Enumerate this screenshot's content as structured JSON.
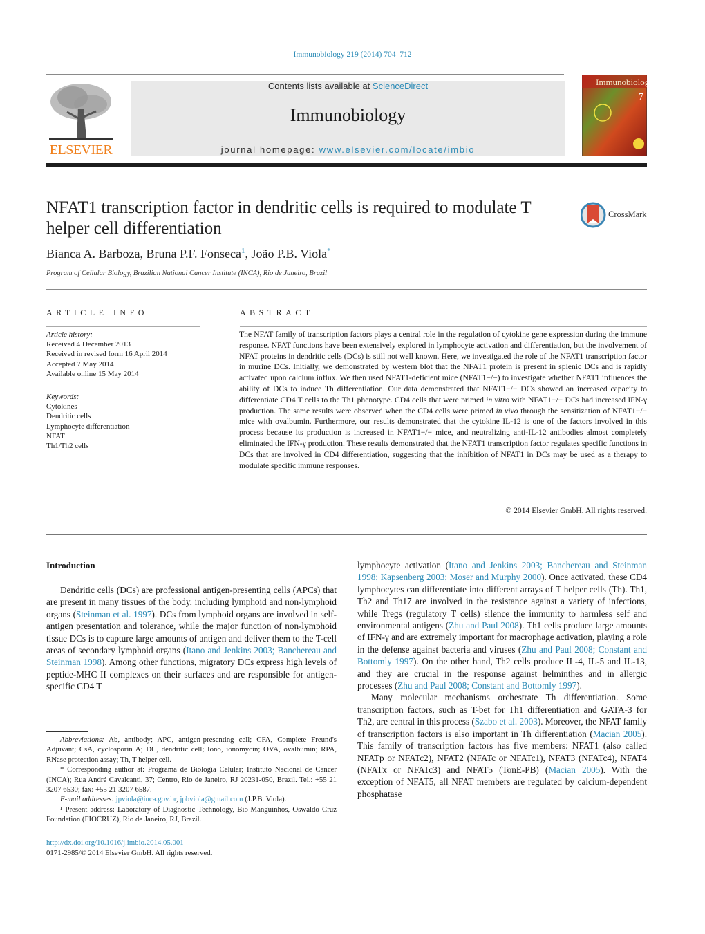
{
  "header": {
    "journal_ref": "Immunobiology 219 (2014) 704–712",
    "contents_prefix": "Contents lists available at ",
    "contents_link": "ScienceDirect",
    "journal_name": "Immunobiology",
    "homepage_prefix": "journal homepage: ",
    "homepage_link": "www.elsevier.com/locate/imbio",
    "publisher_logo": "ELSEVIER",
    "cover_title": "Immunobiology",
    "cover_issue": "7",
    "crossmark_label": "CrossMark"
  },
  "article": {
    "title": "NFAT1 transcription factor in dendritic cells is required to modulate T helper cell differentiation",
    "authors": [
      {
        "name": "Bianca A. Barboza",
        "mark": ""
      },
      {
        "name": "Bruna P.F. Fonseca",
        "mark": "1"
      },
      {
        "name": "João P.B. Viola",
        "mark": "*"
      }
    ],
    "affiliation": "Program of Cellular Biology, Brazilian National Cancer Institute (INCA), Rio de Janeiro, Brazil"
  },
  "article_info": {
    "heading": "ARTICLE INFO",
    "history_label": "Article history:",
    "history": [
      "Received 4 December 2013",
      "Received in revised form 16 April 2014",
      "Accepted 7 May 2014",
      "Available online 15 May 2014"
    ],
    "keywords_label": "Keywords:",
    "keywords": [
      "Cytokines",
      "Dendritic cells",
      "Lymphocyte differentiation",
      "NFAT",
      "Th1/Th2 cells"
    ]
  },
  "abstract": {
    "heading": "ABSTRACT",
    "p1": "The NFAT family of transcription factors plays a central role in the regulation of cytokine gene expression during the immune response. NFAT functions have been extensively explored in lymphocyte activation and differentiation, but the involvement of NFAT proteins in dendritic cells (DCs) is still not well known. Here, we investigated the role of the NFAT1 transcription factor in murine DCs. Initially, we demonstrated by western blot that the NFAT1 protein is present in splenic DCs and is rapidly activated upon calcium influx. We then used NFAT1-deficient mice (NFAT1−/−) to investigate whether NFAT1 influences the ability of DCs to induce Th differentiation. Our data demonstrated that NFAT1−/− DCs showed an increased capacity to differentiate CD4 T cells to the Th1 phenotype. CD4 cells that were primed ",
    "it1": "in vitro",
    "p2": " with NFAT1−/− DCs had increased IFN-γ production. The same results were observed when the CD4 cells were primed ",
    "it2": "in vivo",
    "p3": " through the sensitization of NFAT1−/− mice with ovalbumin. Furthermore, our results demonstrated that the cytokine IL-12 is one of the factors involved in this process because its production is increased in NFAT1−/− mice, and neutralizing anti-IL-12 antibodies almost completely eliminated the IFN-γ production. These results demonstrated that the NFAT1 transcription factor regulates specific functions in DCs that are involved in CD4 differentiation, suggesting that the inhibition of NFAT1 in DCs may be used as a therapy to modulate specific immune responses.",
    "copyright": "© 2014 Elsevier GmbH. All rights reserved."
  },
  "body": {
    "intro_heading": "Introduction",
    "left": [
      {
        "t": "Dendritic cells (DCs) are professional antigen-presenting cells (APCs) that are present in many tissues of the body, including lymphoid and non-lymphoid organs ("
      },
      {
        "l": "Steinman et al. 1997"
      },
      {
        "t": "). DCs from lymphoid organs are involved in self-antigen presentation and tolerance, while the major function of non-lymphoid tissue DCs is to capture large amounts of antigen and deliver them to the T-cell areas of secondary lymphoid organs ("
      },
      {
        "l": "Itano and Jenkins 2003; Banchereau and Steinman 1998"
      },
      {
        "t": "). Among other functions, migratory DCs express high levels of peptide-MHC II complexes on their surfaces and are responsible for antigen-specific CD4 T"
      }
    ],
    "right_p1": [
      {
        "t": "lymphocyte activation ("
      },
      {
        "l": "Itano and Jenkins 2003; Banchereau and Steinman 1998; Kapsenberg 2003; Moser and Murphy 2000"
      },
      {
        "t": "). Once activated, these CD4 lymphocytes can differentiate into different arrays of T helper cells (Th). Th1, Th2 and Th17 are involved in the resistance against a variety of infections, while Tregs (regulatory T cells) silence the immunity to harmless self and environmental antigens ("
      },
      {
        "l": "Zhu and Paul 2008"
      },
      {
        "t": "). Th1 cells produce large amounts of IFN-γ and are extremely important for macrophage activation, playing a role in the defense against bacteria and viruses ("
      },
      {
        "l": "Zhu and Paul 2008; Constant and Bottomly 1997"
      },
      {
        "t": "). On the other hand, Th2 cells produce IL-4, IL-5 and IL-13, and they are crucial in the response against helminthes and in allergic processes ("
      },
      {
        "l": "Zhu and Paul 2008; Constant and Bottomly 1997"
      },
      {
        "t": ")."
      }
    ],
    "right_p2": [
      {
        "t": "Many molecular mechanisms orchestrate Th differentiation. Some transcription factors, such as T-bet for Th1 differentiation and GATA-3 for Th2, are central in this process ("
      },
      {
        "l": "Szabo et al. 2003"
      },
      {
        "t": "). Moreover, the NFAT family of transcription factors is also important in Th differentiation ("
      },
      {
        "l": "Macian 2005"
      },
      {
        "t": "). This family of transcription factors has five members: NFAT1 (also called NFATp or NFATc2), NFAT2 (NFATc or NFATc1), NFAT3 (NFATc4), NFAT4 (NFATx or NFATc3) and NFAT5 (TonE-PB) ("
      },
      {
        "l": "Macian 2005"
      },
      {
        "t": "). With the exception of NFAT5, all NFAT members are regulated by calcium-dependent phosphatase"
      }
    ]
  },
  "footnotes": {
    "abbrev_label": "Abbreviations:",
    "abbrev": " Ab, antibody; APC, antigen-presenting cell; CFA, Complete Freund's Adjuvant; CsA, cyclosporin A; DC, dendritic cell; Iono, ionomycin; OVA, ovalbumin; RPA, RNase protection assay; Th, T helper cell.",
    "corresponding": "* Corresponding author at: Programa de Biologia Celular; Instituto Nacional de Câncer (INCA); Rua André Cavalcanti, 37; Centro, Rio de Janeiro, RJ 20231-050, Brazil. Tel.: +55 21 3207 6530; fax: +55 21 3207 6587.",
    "email_label": "E-mail addresses:",
    "email1": "jpviola@inca.gov.br",
    "email2": "jpbviola@gmail.com",
    "email_owner": " (J.P.B. Viola).",
    "present_address": "¹ Present address: Laboratory of Diagnostic Technology, Bio-Manguinhos, Oswaldo Cruz Foundation (FIOCRUZ), Rio de Janeiro, RJ, Brazil.",
    "doi": "http://dx.doi.org/10.1016/j.imbio.2014.05.001",
    "issn": "0171-2985/© 2014 Elsevier GmbH. All rights reserved."
  }
}
